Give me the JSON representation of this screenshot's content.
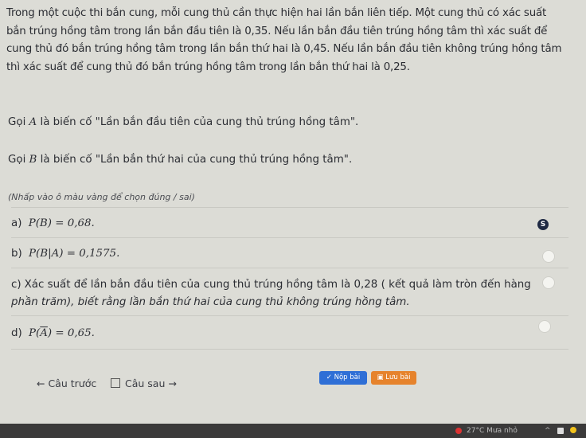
{
  "problem": {
    "lines": [
      "Trong một cuộc thi bắn cung, mỗi cung thủ cần thực hiện hai lần bắn liên tiếp. Một cung thủ có xác suất",
      "bắn trúng hồng tâm trong lần bắn đầu tiên là 0,35. Nếu lần bắn đầu tiên trúng hồng tâm thì xác suất để",
      "cung thủ đó bắn trúng hồng tâm trong lần bắn thứ hai là 0,45. Nếu lần bắn đầu tiên không trúng hồng tâm",
      "thì xác suất để cung thủ đó bắn trúng hồng tâm trong lần bắn thứ hai là 0,25."
    ],
    "event_a": {
      "prefix": "Gọi ",
      "var": "A",
      "suffix": " là biến cố \"Lần bắn đầu tiên của cung thủ trúng hồng tâm\"."
    },
    "event_b": {
      "prefix": "Gọi ",
      "var": "B",
      "suffix": " là biến cố \"Lần bắn thứ hai của cung thủ trúng hồng tâm\"."
    },
    "hint": "(Nhấp vào ô màu vàng để chọn đúng / sai)"
  },
  "statements": [
    {
      "label": "a)",
      "math": "P(B) = 0,68.",
      "state": "S"
    },
    {
      "label": "b)",
      "math": "P(B|A) = 0,1575.",
      "state": ""
    },
    {
      "label": "c)",
      "line1": "Xác suất để lần bắn đầu tiên của cung thủ trúng hồng tâm là 0,28 ( kết quả làm tròn đến hàng",
      "line2": "phần trăm), biết rằng lần bắn thứ hai của cung thủ không trúng hồng tâm.",
      "state": ""
    },
    {
      "label": "d)",
      "math_pre": "P(",
      "math_var": "A",
      "math_post": ") = 0,65.",
      "state": ""
    }
  ],
  "nav": {
    "prev": "← Câu trước",
    "next": "Câu sau →",
    "submit": "Nộp bài",
    "save": "Lưu bài"
  },
  "taskbar": {
    "weather": "27°C  Mưa nhỏ"
  },
  "colors": {
    "background": "#dcdcd6",
    "submit": "#2f6fd6",
    "save": "#e6832c",
    "badge": "#1f2a44"
  }
}
